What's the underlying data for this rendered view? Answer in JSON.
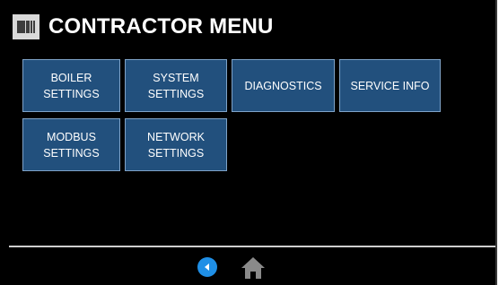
{
  "header": {
    "title": "CONTRACTOR MENU",
    "logo_icon": "app-logo-icon"
  },
  "menu": {
    "buttons": [
      {
        "label": "BOILER\nSETTINGS"
      },
      {
        "label": "SYSTEM\nSETTINGS"
      },
      {
        "label": "DIAGNOSTICS"
      },
      {
        "label": "SERVICE INFO"
      },
      {
        "label": "MODBUS\nSETTINGS"
      },
      {
        "label": "NETWORK\nSETTINGS"
      }
    ]
  },
  "nav": {
    "back_icon": "back-arrow-icon",
    "home_icon": "home-icon"
  },
  "colors": {
    "background": "#000000",
    "button_fill": "#22507d",
    "button_border": "#7fa3c8",
    "back_button": "#1f8fe6",
    "home_icon": "#8a8a8a"
  }
}
